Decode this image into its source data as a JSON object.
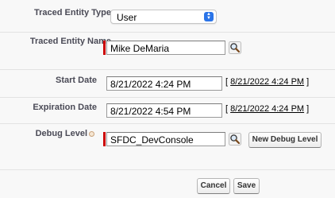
{
  "form": {
    "traced_entity_type": {
      "label": "Traced Entity Type",
      "value": "User"
    },
    "traced_entity_name": {
      "label": "Traced Entity Name",
      "value": "Mike DeMaria"
    },
    "start_date": {
      "label": "Start Date",
      "value": "8/21/2022 4:24 PM",
      "link": "8/21/2022 4:24 PM",
      "open_bracket": "[",
      "close_bracket": "]"
    },
    "expiration_date": {
      "label": "Expiration Date",
      "value": "8/21/2022 4:54 PM",
      "link": "8/21/2022 4:24 PM",
      "open_bracket": "[",
      "close_bracket": "]"
    },
    "debug_level": {
      "label": "Debug Level",
      "value": "SFDC_DevConsole",
      "new_button": "New Debug Level"
    }
  },
  "actions": {
    "cancel_label": "Cancel",
    "save_label": "Save"
  },
  "colors": {
    "required_bar": "#cc0000",
    "select_arrow": "#2a74e8"
  },
  "icons": {
    "lookup": "magnifier-lookup-icon",
    "help": "help-icon",
    "select_arrows": "up-down-chevron-icon"
  }
}
